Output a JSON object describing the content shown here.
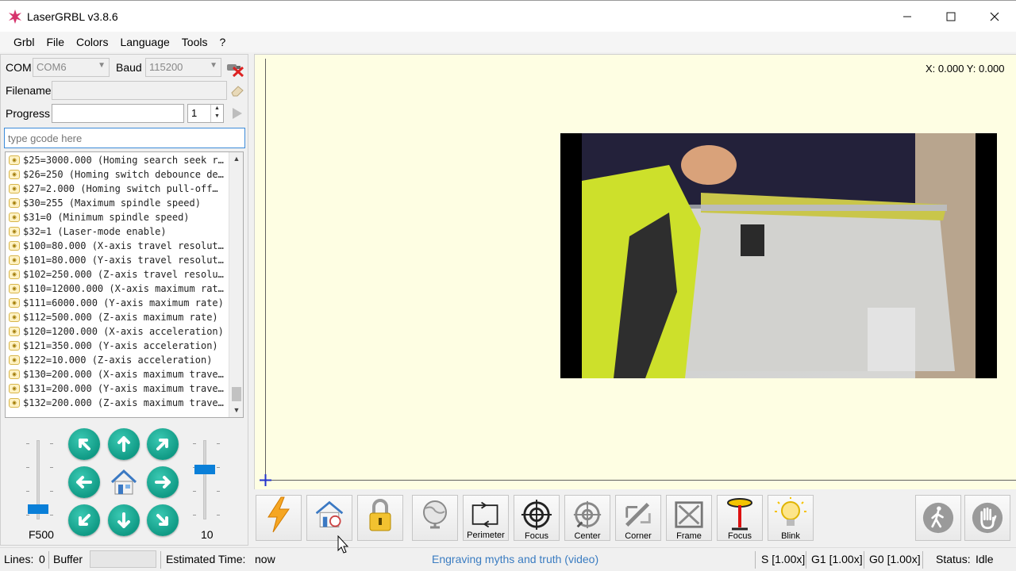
{
  "window": {
    "title": "LaserGRBL v3.8.6"
  },
  "menu": [
    "Grbl",
    "File",
    "Colors",
    "Language",
    "Tools",
    "?"
  ],
  "connection": {
    "com_label": "COM",
    "com_value": "COM6",
    "baud_label": "Baud",
    "baud_value": "115200",
    "filename_label": "Filename",
    "progress_label": "Progress",
    "copies_value": "1"
  },
  "gcode_input": {
    "placeholder": "type gcode here"
  },
  "console_lines": [
    "$25=3000.000 (Homing search seek r…",
    "$26=250 (Homing switch debounce de…",
    "$27=2.000 (Homing switch pull-off…",
    "$30=255 (Maximum spindle speed)",
    "$31=0 (Minimum spindle speed)",
    "$32=1 (Laser-mode enable)",
    "$100=80.000 (X-axis travel resolut…",
    "$101=80.000 (Y-axis travel resolut…",
    "$102=250.000 (Z-axis travel resolu…",
    "$110=12000.000 (X-axis maximum rat…",
    "$111=6000.000 (Y-axis maximum rate)",
    "$112=500.000 (Z-axis maximum rate)",
    "$120=1200.000 (X-axis acceleration)",
    "$121=350.000 (Y-axis acceleration)",
    "$122=10.000 (Z-axis acceleration)",
    "$130=200.000 (X-axis maximum trave…",
    "$131=200.000 (Y-axis maximum trave…",
    "$132=200.000 (Z-axis maximum trave…"
  ],
  "jog": {
    "speed_label": "F500",
    "step_label": "10"
  },
  "canvas": {
    "coords": "X: 0.000 Y: 0.000"
  },
  "toolbar": {
    "buttons": [
      {
        "name": "connect",
        "caption": ""
      },
      {
        "name": "homing",
        "caption": ""
      },
      {
        "name": "unlock",
        "caption": ""
      },
      {
        "name": "globe",
        "caption": ""
      },
      {
        "name": "perimeter",
        "caption": "Perimeter"
      },
      {
        "name": "focus-target",
        "caption": "Focus"
      },
      {
        "name": "center",
        "caption": "Center"
      },
      {
        "name": "corner",
        "caption": "Corner"
      },
      {
        "name": "frame",
        "caption": "Frame"
      },
      {
        "name": "focus-laser",
        "caption": "Focus"
      },
      {
        "name": "blink",
        "caption": "Blink"
      }
    ]
  },
  "status": {
    "lines_label": "Lines:",
    "lines_value": "0",
    "buffer_label": "Buffer",
    "est_label": "Estimated Time:",
    "est_value": "now",
    "overlay_link": "Engraving myths and truth (video)",
    "s_override": "S [1.00x]",
    "g1_override": "G1 [1.00x]",
    "g0_override": "G0 [1.00x]",
    "status_label": "Status:",
    "status_value": "Idle"
  },
  "colors": {
    "accent": "#0a7fd8",
    "jog": "#109a85",
    "canvas": "#fefee3",
    "link": "#3a7cc1"
  }
}
